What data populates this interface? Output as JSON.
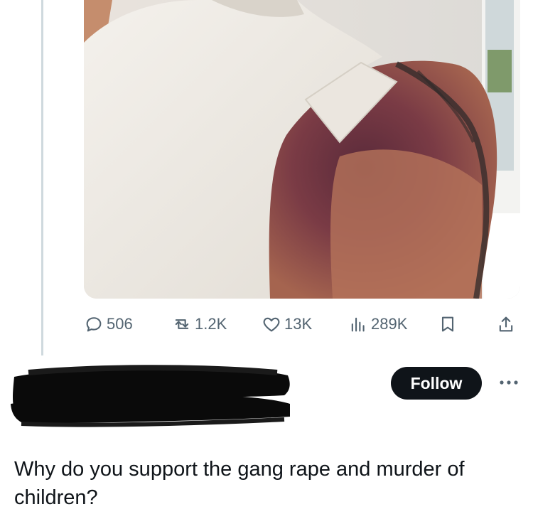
{
  "actions": {
    "replies": "506",
    "reposts": "1.2K",
    "likes": "13K",
    "views": "289K"
  },
  "follow_label": "Follow",
  "post_text": "Why do you support the gang rape and murder of children?",
  "icons": [
    "reply-icon",
    "repost-icon",
    "like-icon",
    "views-icon",
    "bookmark-icon",
    "share-icon",
    "more-icon"
  ],
  "colors": {
    "follow_button": "#0f1419",
    "action_gray": "#536471",
    "thread_line": "#cfd9de"
  }
}
